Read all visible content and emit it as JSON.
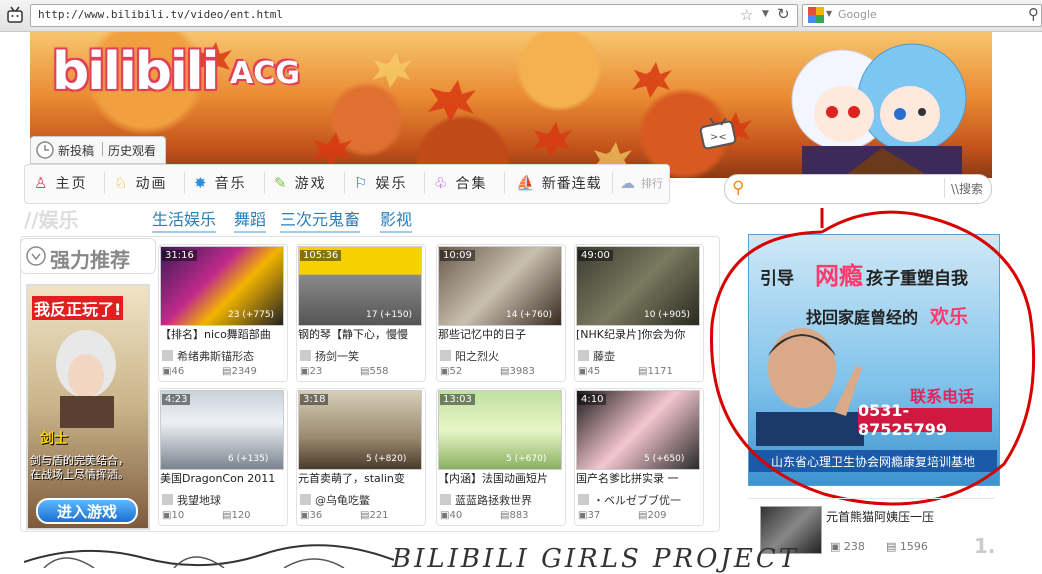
{
  "browser": {
    "url": "http://www.bilibili.tv/video/ent.html",
    "search_placeholder": "Google"
  },
  "banner": {
    "logo_text": "bilibili",
    "logo_suffix": "ACG",
    "post_label": "新投稿",
    "history_label": "历史观看"
  },
  "nav": {
    "items": [
      {
        "label": "主页",
        "icon": "dress-icon"
      },
      {
        "label": "动画",
        "icon": "bunny-icon"
      },
      {
        "label": "音乐",
        "icon": "star-icon"
      },
      {
        "label": "游戏",
        "icon": "gamepad-icon"
      },
      {
        "label": "娱乐",
        "icon": "flag-icon"
      },
      {
        "label": "合集",
        "icon": "ghost-icon"
      },
      {
        "label": "新番连载",
        "icon": "boat-icon"
      },
      {
        "label": "排行",
        "icon": "cloud-icon"
      }
    ]
  },
  "site_search": {
    "button": "\\\\搜索",
    "placeholder": ""
  },
  "section": {
    "title": "//娱乐",
    "tabs": [
      "生活娱乐",
      "舞蹈",
      "三次元鬼畜",
      "影视"
    ]
  },
  "recommend": {
    "title": "强力推荐"
  },
  "game_ad": {
    "top": "我反正玩了!",
    "role": "剑士",
    "line1": "剑与盾的完美结合，",
    "line2": "在战场上尽情挥洒。",
    "button": "进入游戏"
  },
  "videos": [
    {
      "duration": "31:16",
      "count": "23 (+775)",
      "title": "【排名】nico舞蹈部曲",
      "uploader": "希绪弗斯锚形态",
      "s1": "46",
      "s2": "2349"
    },
    {
      "duration": "105:36",
      "count": "17 (+150)",
      "title": "钢的琴【静下心，慢慢",
      "uploader": "扬剑一笑",
      "s1": "23",
      "s2": "558"
    },
    {
      "duration": "10:09",
      "count": "14 (+760)",
      "title": "那些记忆中的日子",
      "uploader": "阳之烈火",
      "s1": "52",
      "s2": "3983"
    },
    {
      "duration": "49:00",
      "count": "10 (+905)",
      "title": "[NHK纪录片]你会为你",
      "uploader": "藤壶",
      "s1": "45",
      "s2": "1171"
    },
    {
      "duration": "4:23",
      "count": "6 (+135)",
      "title": "美国DragonCon 2011",
      "uploader": "我望地球",
      "s1": "10",
      "s2": "120"
    },
    {
      "duration": "3:18",
      "count": "5 (+820)",
      "title": "元首卖萌了，stalin变",
      "uploader": "@乌龟吃鳖",
      "s1": "36",
      "s2": "221"
    },
    {
      "duration": "13:03",
      "count": "5 (+670)",
      "title": "【内涵】法国动画短片",
      "uploader": "蓝蓝路拯救世界",
      "s1": "40",
      "s2": "883"
    },
    {
      "duration": "4:10",
      "count": "5 (+650)",
      "title": "国产名爹比拼实录 一",
      "uploader": "・ベルゼブブ优一",
      "s1": "37",
      "s2": "209"
    }
  ],
  "ad": {
    "line1a": "引导",
    "line1b": "网瘾",
    "line1c": "孩子重塑自我",
    "line2a": "找回家庭曾经的",
    "line2b": "欢乐",
    "contact": "联系电话",
    "phone": "0531-87525799",
    "footer": "山东省心理卫生协会网瘾康复培训基地"
  },
  "side_video": {
    "title": "元首熊猫阿姨压一压",
    "s1": "238",
    "s2": "1596",
    "rank": "1."
  },
  "bottom": {
    "title": "BILIBILI GIRLS PROJECT"
  },
  "colors": {
    "accent": "#2a7fb8",
    "pink": "#e2405a",
    "ad_red": "#d01840",
    "ring": "#d80000"
  }
}
